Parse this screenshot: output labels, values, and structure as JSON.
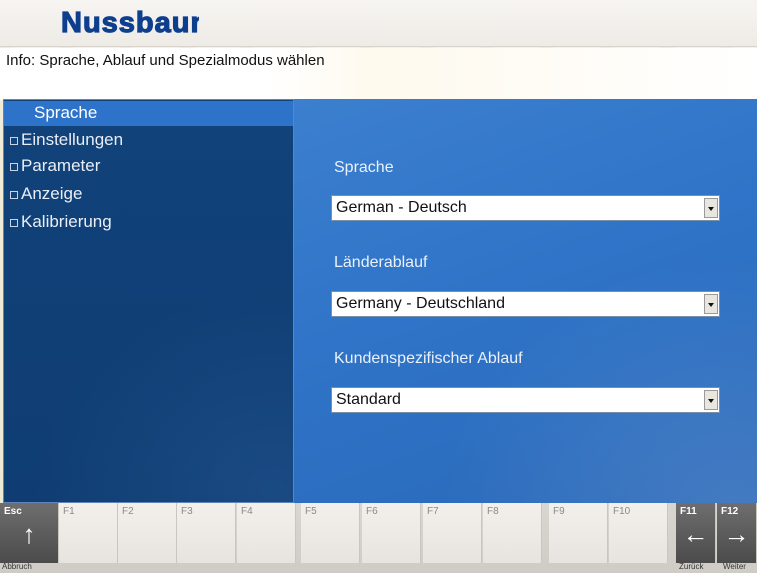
{
  "brand": {
    "logo_text": "Nussbaum"
  },
  "info": {
    "text": "Info: Sprache, Ablauf und Spezialmodus wählen"
  },
  "tree": {
    "items": [
      {
        "label": "Sprache",
        "selected": true,
        "expandable": false
      },
      {
        "label": "Einstellungen",
        "selected": false,
        "expandable": true
      },
      {
        "label": "Parameter",
        "selected": false,
        "expandable": true
      },
      {
        "label": "Anzeige",
        "selected": false,
        "expandable": true
      },
      {
        "label": "Kalibrierung",
        "selected": false,
        "expandable": true
      }
    ],
    "expander_glyph": "⊞"
  },
  "content": {
    "fields": [
      {
        "label": "Sprache",
        "value": "German - Deutsch"
      },
      {
        "label": "Länderablauf",
        "value": "Germany - Deutschland"
      },
      {
        "label": "Kundenspezifischer Ablauf",
        "value": "Standard"
      }
    ]
  },
  "fkeys": {
    "esc": {
      "code": "Esc",
      "icon": "arrow-up-icon",
      "caption": "Abbruch"
    },
    "keys": [
      "F1",
      "F2",
      "F3",
      "F4",
      "F5",
      "F6",
      "F7",
      "F8",
      "F9",
      "F10"
    ],
    "f11": {
      "code": "F11",
      "icon": "arrow-left-icon",
      "caption": "Zurück"
    },
    "f12": {
      "code": "F12",
      "icon": "arrow-right-icon",
      "caption": "Weiter"
    }
  },
  "colors": {
    "tree_bg": "#0f3d73",
    "tree_selected": "#2d73c9",
    "content_bg": "#2f74c8",
    "logo_blue": "#0d3f8e"
  }
}
